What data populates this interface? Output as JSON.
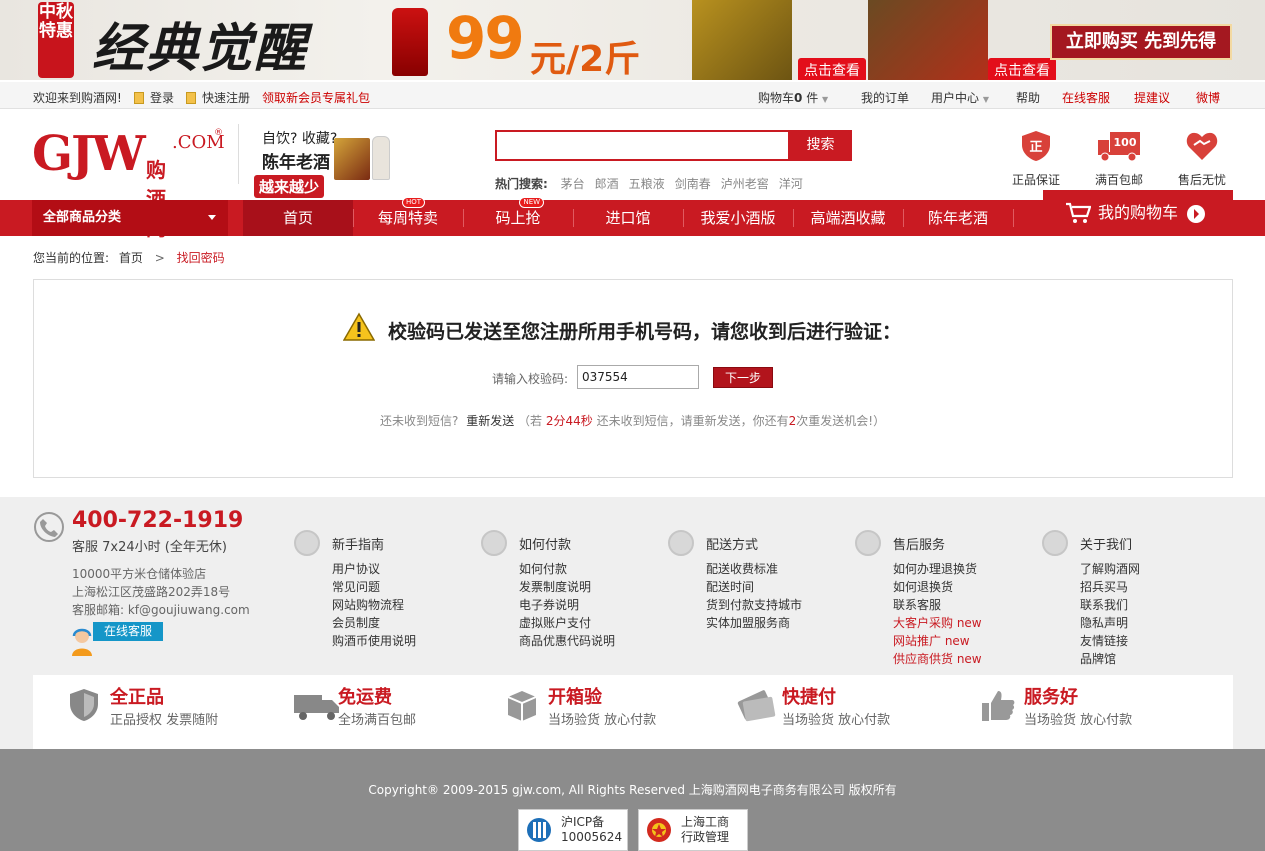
{
  "banner": {
    "stamp": "中秋特惠",
    "headline": "经典觉醒",
    "price": "99",
    "price_unit": "元/2斤",
    "see_label_1": "点击查看",
    "see_label_2": "点击查看",
    "cta": "立即购买 先到先得"
  },
  "topbar": {
    "welcome": "欢迎来到购酒网!",
    "login": "登录",
    "register": "快速注册",
    "gift": "领取新会员专属礼包",
    "cart_label": "购物车",
    "cart_count": "0",
    "cart_unit": "件",
    "orders": "我的订单",
    "user_center": "用户中心",
    "help": "帮助",
    "online_service": "在线客服",
    "suggest": "提建议",
    "weibo": "微博"
  },
  "header": {
    "logo_text": "GJW",
    "logo_com": ".COM",
    "logo_reg": "®",
    "logo_cn": "购酒网",
    "slogan_line1": "自饮? 收藏?",
    "slogan_line2": "陈年老酒",
    "slogan_line3": "越来越少",
    "search_value": "",
    "search_button": "搜索",
    "hot_label": "热门搜索:",
    "hot_keywords": [
      "茅台",
      "郎酒",
      "五粮液",
      "剑南春",
      "泸州老窖",
      "洋河"
    ],
    "services": [
      {
        "label": "正品保证",
        "icon": "shield-icon"
      },
      {
        "label": "满百包邮",
        "icon": "truck-icon"
      },
      {
        "label": "售后无忧",
        "icon": "heart-handshake-icon"
      }
    ]
  },
  "nav": {
    "all_categories": "全部商品分类",
    "items": [
      {
        "label": "首页",
        "tag": ""
      },
      {
        "label": "每周特卖",
        "tag": "HOT"
      },
      {
        "label": "码上抢",
        "tag": "NEW"
      },
      {
        "label": "进口馆",
        "tag": ""
      },
      {
        "label": "我爱小酒版",
        "tag": ""
      },
      {
        "label": "高端酒收藏",
        "tag": ""
      },
      {
        "label": "陈年老酒",
        "tag": ""
      }
    ],
    "cart": "我的购物车"
  },
  "breadcrumb": {
    "prefix": "您当前的位置:",
    "home": "首页",
    "sep": ">",
    "current": "找回密码"
  },
  "main": {
    "message": "校验码已发送至您注册所用手机号码，请您收到后进行验证：",
    "code_label": "请输入校验码:",
    "code_value": "037554",
    "next_button": "下一步",
    "resend_prefix": "还未收到短信?",
    "resend_link": "重新发送",
    "resend_open": "（若",
    "countdown": "2分44秒",
    "resend_mid": "还未收到短信，请重新发送，你还有",
    "remaining": "2",
    "resend_end": "次重发送机会!）"
  },
  "footer": {
    "phone": "400-722-1919",
    "hours": "客服 7x24小时 (全年无休)",
    "addr1": "10000平方米仓储体验店",
    "addr2": "上海松江区茂盛路202弄18号",
    "email": "客服邮箱: kf@goujiuwang.com",
    "online_service": "在线客服",
    "columns": [
      {
        "title": "新手指南",
        "links": [
          {
            "t": "用户协议"
          },
          {
            "t": "常见问题"
          },
          {
            "t": "网站购物流程"
          },
          {
            "t": "会员制度"
          },
          {
            "t": "购酒币使用说明"
          }
        ]
      },
      {
        "title": "如何付款",
        "links": [
          {
            "t": "如何付款"
          },
          {
            "t": "发票制度说明"
          },
          {
            "t": "电子券说明"
          },
          {
            "t": "虚拟账户支付"
          },
          {
            "t": "商品优惠代码说明"
          }
        ]
      },
      {
        "title": "配送方式",
        "links": [
          {
            "t": "配送收费标准"
          },
          {
            "t": "配送时间"
          },
          {
            "t": "货到付款支持城市"
          },
          {
            "t": "实体加盟服务商"
          }
        ]
      },
      {
        "title": "售后服务",
        "links": [
          {
            "t": "如何办理退换货"
          },
          {
            "t": "如何退换货"
          },
          {
            "t": "联系客服"
          },
          {
            "t": "大客户采购 new",
            "hl": true
          },
          {
            "t": "网站推广 new",
            "hl": true
          },
          {
            "t": "供应商供货 new",
            "hl": true
          }
        ]
      },
      {
        "title": "关于我们",
        "links": [
          {
            "t": "了解购酒网"
          },
          {
            "t": "招兵买马"
          },
          {
            "t": "联系我们"
          },
          {
            "t": "隐私声明"
          },
          {
            "t": "友情链接"
          },
          {
            "t": "品牌馆"
          }
        ]
      }
    ],
    "guarantees": [
      {
        "title": "全正品",
        "sub": "正品授权 发票随附",
        "icon": "shield-icon"
      },
      {
        "title": "免运费",
        "sub": "全场满百包邮",
        "icon": "truck-icon"
      },
      {
        "title": "开箱验",
        "sub": "当场验货 放心付款",
        "icon": "box-icon"
      },
      {
        "title": "快捷付",
        "sub": "当场验货 放心付款",
        "icon": "card-icon"
      },
      {
        "title": "服务好",
        "sub": "当场验货 放心付款",
        "icon": "thumbs-up-icon"
      }
    ],
    "copyright": "Copyright® 2009-2015 gjw.com, All Rights Reserved 上海购酒网电子商务有限公司 版权所有",
    "badge1_line1": "沪ICP备",
    "badge1_line2": "10005624",
    "badge2_line1": "上海工商",
    "badge2_line2": "行政管理"
  },
  "colors": {
    "brand_red": "#c91a22",
    "link_blue": "#1596c8",
    "footer_gray": "#8c8c8c"
  }
}
